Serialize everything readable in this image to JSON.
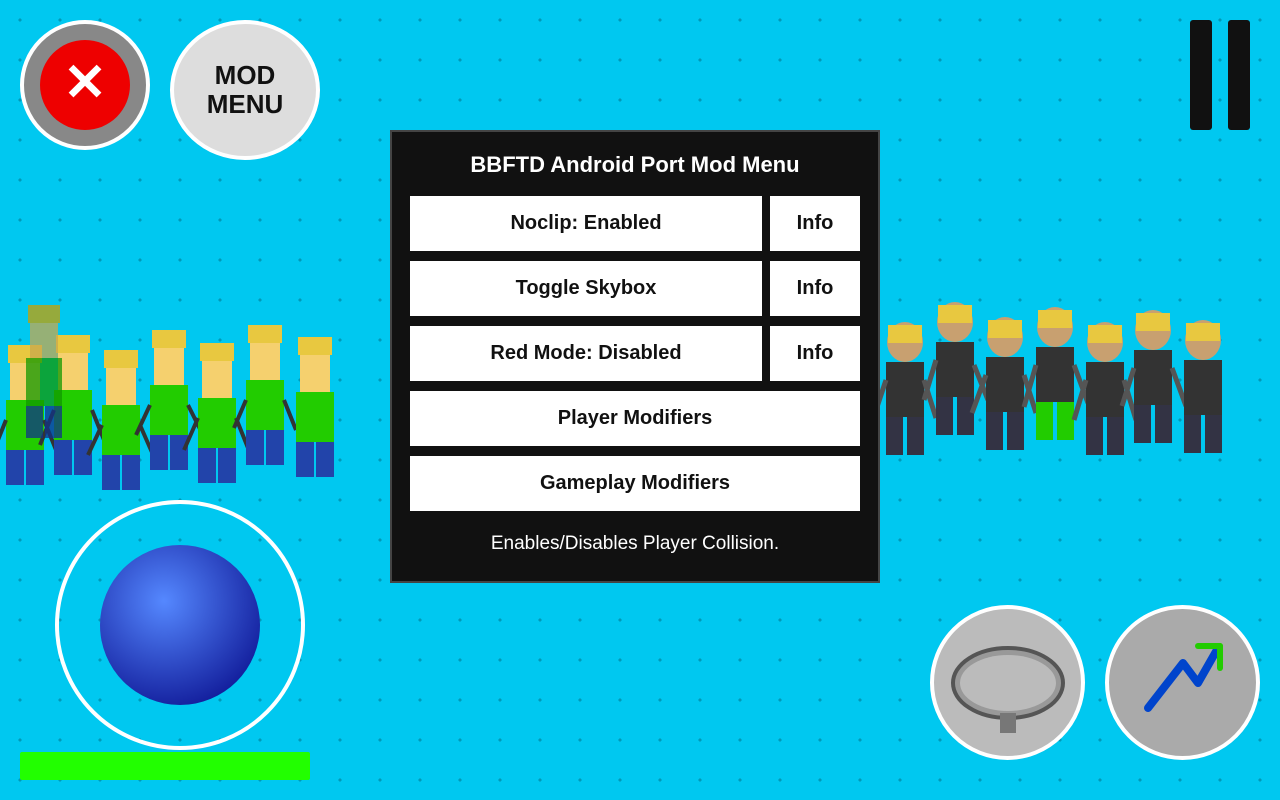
{
  "title": "BBFTD Android Port Mod Menu",
  "close_button": "×",
  "mod_menu_label": [
    "MOD",
    "MENU"
  ],
  "pause_bars": 2,
  "buttons": [
    {
      "id": "noclip",
      "label": "Noclip: Enabled",
      "has_info": true,
      "info_label": "Info"
    },
    {
      "id": "toggle-skybox",
      "label": "Toggle Skybox",
      "has_info": true,
      "info_label": "Info"
    },
    {
      "id": "red-mode",
      "label": "Red Mode: Disabled",
      "has_info": true,
      "info_label": "Info"
    },
    {
      "id": "player-modifiers",
      "label": "Player Modifiers",
      "has_info": false
    },
    {
      "id": "gameplay-modifiers",
      "label": "Gameplay Modifiers",
      "has_info": false
    }
  ],
  "description": "Enables/Disables Player Collision.",
  "green_bar": true
}
